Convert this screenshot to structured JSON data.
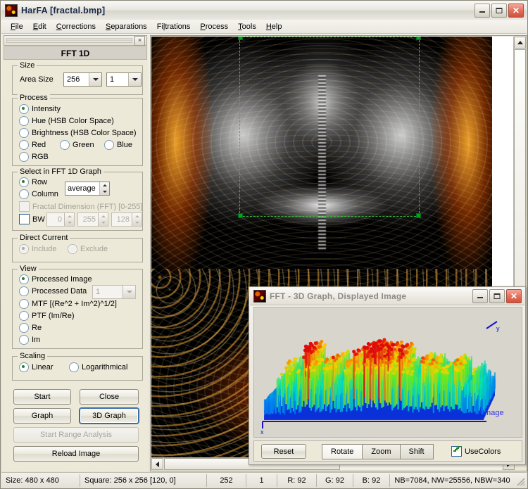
{
  "window": {
    "title": "HarFA [fractal.bmp]",
    "icon": "app-icon",
    "buttons": {
      "minimize": "minimize",
      "maximize": "maximize",
      "close": "close"
    }
  },
  "menu": {
    "items": [
      "File",
      "Edit",
      "Corrections",
      "Separations",
      "Filtrations",
      "Process",
      "Tools",
      "Help"
    ]
  },
  "panel": {
    "close_label": "×",
    "title": "FFT 1D",
    "size": {
      "legend": "Size",
      "area_size_label": "Area Size",
      "area_size_value": "256",
      "area_count_value": "1"
    },
    "process": {
      "legend": "Process",
      "options": [
        {
          "label": "Intensity",
          "selected": true
        },
        {
          "label": "Hue (HSB Color Space)",
          "selected": false
        },
        {
          "label": "Brightness (HSB Color Space)",
          "selected": false
        },
        {
          "label": "Red",
          "selected": false
        },
        {
          "label": "Green",
          "selected": false
        },
        {
          "label": "Blue",
          "selected": false
        },
        {
          "label": "RGB",
          "selected": false
        }
      ]
    },
    "select_graph": {
      "legend": "Select in FFT 1D Graph",
      "row_label": "Row",
      "column_label": "Column",
      "mode_value": "average",
      "fractal_dim_label": "Fractal Dimension (FFT) [0-255]",
      "bw_label": "BW",
      "bw_min": "0",
      "bw_max": "255",
      "bw_thr": "128"
    },
    "direct_current": {
      "legend": "Direct Current",
      "include_label": "Include",
      "exclude_label": "Exclude"
    },
    "view": {
      "legend": "View",
      "options": [
        {
          "label": "Processed Image",
          "selected": true
        },
        {
          "label": "Processed Data",
          "selected": false
        },
        {
          "label": "MTF [(Re^2 + Im^2)^1/2]",
          "selected": false
        },
        {
          "label": "PTF (Im/Re)",
          "selected": false
        },
        {
          "label": "Re",
          "selected": false
        },
        {
          "label": "Im",
          "selected": false
        }
      ],
      "data_index_value": "1"
    },
    "scaling": {
      "legend": "Scaling",
      "linear_label": "Linear",
      "log_label": "Logarithmical"
    },
    "buttons": {
      "start": "Start",
      "close": "Close",
      "graph": "Graph",
      "graph3d": "3D Graph",
      "range_analysis": "Start Range Analysis",
      "reload": "Reload Image"
    }
  },
  "graph3d": {
    "title": "FFT - 3D Graph, Displayed Image",
    "axis_x": "x",
    "axis_y": "y",
    "series_label": "Image",
    "reset_label": "Reset",
    "modes": [
      {
        "label": "Rotate",
        "selected": true
      },
      {
        "label": "Zoom",
        "selected": false
      },
      {
        "label": "Shift",
        "selected": false
      }
    ],
    "usecolors_label": "UseColors",
    "usecolors_checked": true
  },
  "statusbar": {
    "cells": [
      "Size: 480 x 480",
      "Square: 256 x 256 [120, 0]",
      "252",
      "1",
      "R: 92",
      "G: 92",
      "B: 92",
      "NB=7084, NW=25556, NBW=340"
    ]
  },
  "colors": {
    "accent": "#3a6ea5",
    "selection_green": "#35c135",
    "check_green": "#1b8c1b",
    "close_red": "#d0503c"
  }
}
